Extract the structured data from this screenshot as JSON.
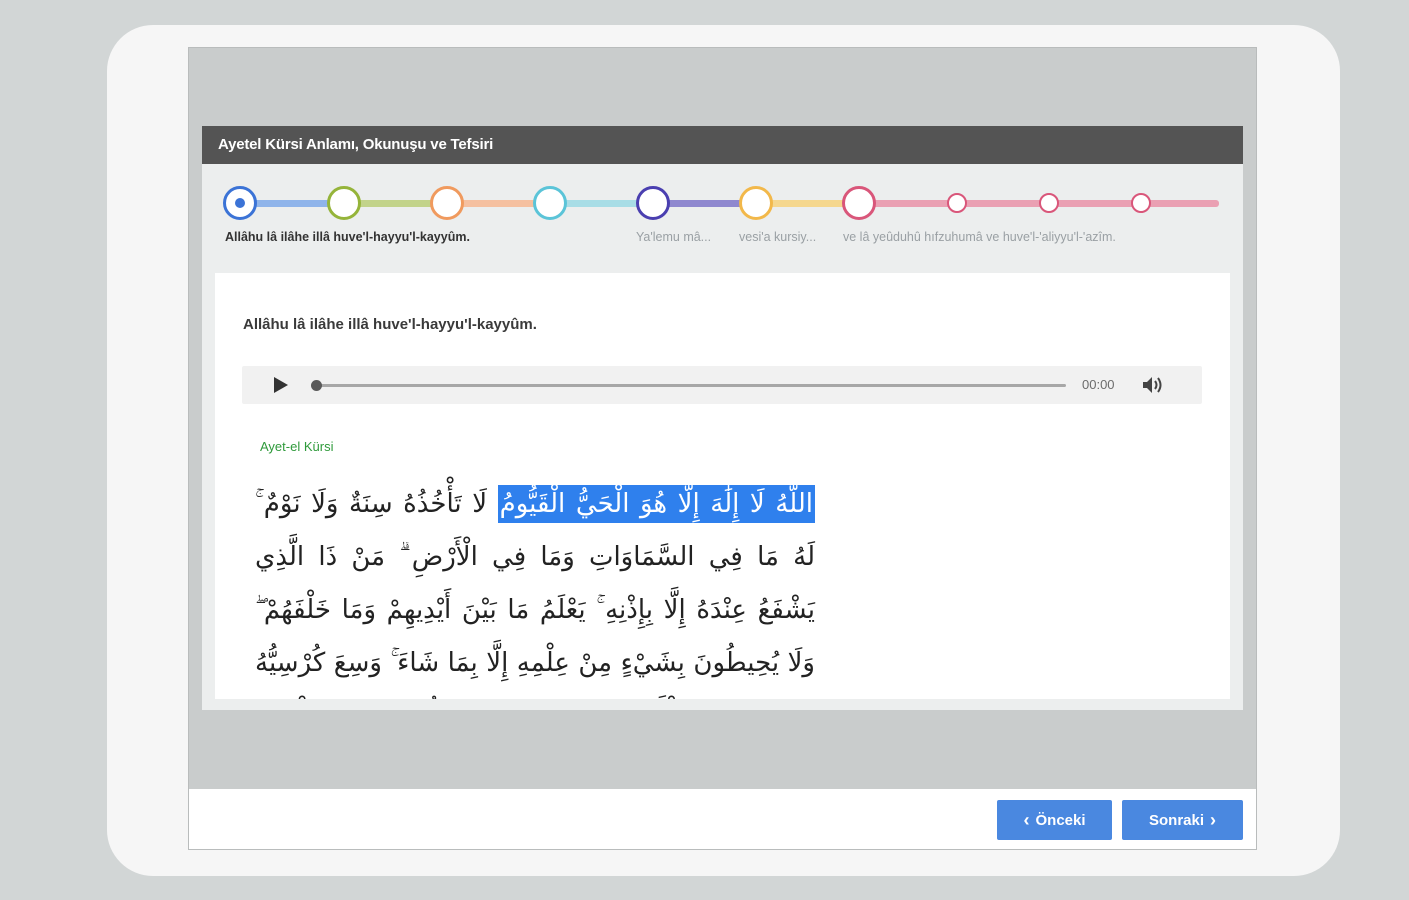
{
  "panel": {
    "title": "Ayetel Kürsi Anlamı, Okunuşu ve Tefsiri"
  },
  "steps": {
    "colors": [
      "#3b73d6",
      "#95b43a",
      "#f09a5e",
      "#5bc4d8",
      "#4a3fb0",
      "#f2b84a",
      "#d9567a",
      "#d9567a",
      "#d9567a",
      "#d9567a"
    ],
    "labels": [
      "Allâhu lâ ilâhe illâ huve'l-hayyu'l-kayyûm.",
      "Ya'lemu mâ...",
      "vesi'a kursiy...",
      "ve lâ yeûduhû hıfzuhumâ ve huve'l-'aliyyu'l-'azîm."
    ],
    "active_index": 0
  },
  "content": {
    "verse_title": "Allâhu lâ ilâhe illâ huve'l-hayyu'l-kayyûm.",
    "source_label": "Ayet-el Kürsi",
    "arabic_highlight": "اللَّهُ لَا إِلَٰهَ إِلَّا هُوَ الْحَيُّ الْقَيُّومُ",
    "arabic_rest": "لَا تَأْخُذُهُ سِنَةٌ وَلَا نَوْمٌ ۚ لَهُ مَا فِي السَّمَاوَاتِ وَمَا فِي الْأَرْضِ ۗ مَنْ ذَا الَّذِي يَشْفَعُ عِنْدَهُ إِلَّا بِإِذْنِهِ ۚ يَعْلَمُ مَا بَيْنَ أَيْدِيهِمْ وَمَا خَلْفَهُمْ ۖ وَلَا يُحِيطُونَ بِشَيْءٍ مِنْ عِلْمِهِ إِلَّا بِمَا شَاءَ ۚ وَسِعَ كُرْسِيُّهُ السَّمَاوَاتِ وَالْأَرْضَ ۖ وَلَا يَئُودُهُ حِفْظُهُمَا ۚ وَهُوَ الْعَلِيُّ الْعَظِيمُ"
  },
  "audio": {
    "time": "00:00",
    "progress": 0
  },
  "footer": {
    "prev_label": "Önceki",
    "next_label": "Sonraki"
  }
}
